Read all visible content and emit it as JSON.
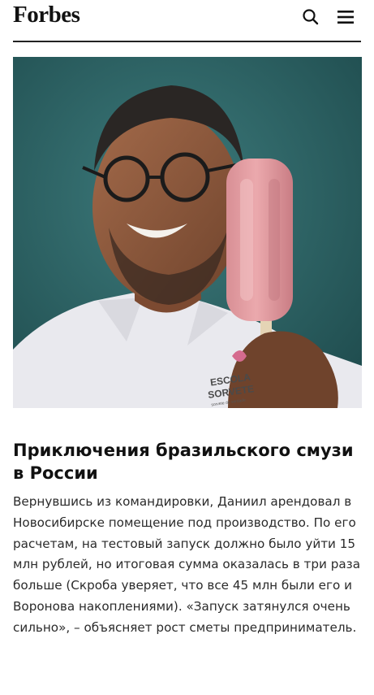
{
  "header": {
    "logo": "Forbes",
    "search_icon": "search-icon",
    "menu_icon": "hamburger-menu-icon"
  },
  "hero": {
    "shirt_logo_line1": "ESCOLA",
    "shirt_logo_line2": "SORVETE",
    "shirt_logo_line3": "sorvete de verdade"
  },
  "article": {
    "headline": "Приключения бразильского смузи в России",
    "body": "Вернувшись из командировки, Даниил арендовал в Новосибирске помещение под производство. По его расчетам, на тестовый запуск должно было уйти 15 млн рублей, но итоговая сумма оказалась в три раза больше (Скроба уверяет, что все 45 млн были его и Воронова накоплениями). «Запуск затянулся очень сильно», – объясняет рост сметы предприниматель."
  },
  "colors": {
    "background": "#ffffff",
    "photo_background": "#2f6466",
    "popsicle": "#e8a0a5",
    "text": "#111111"
  }
}
